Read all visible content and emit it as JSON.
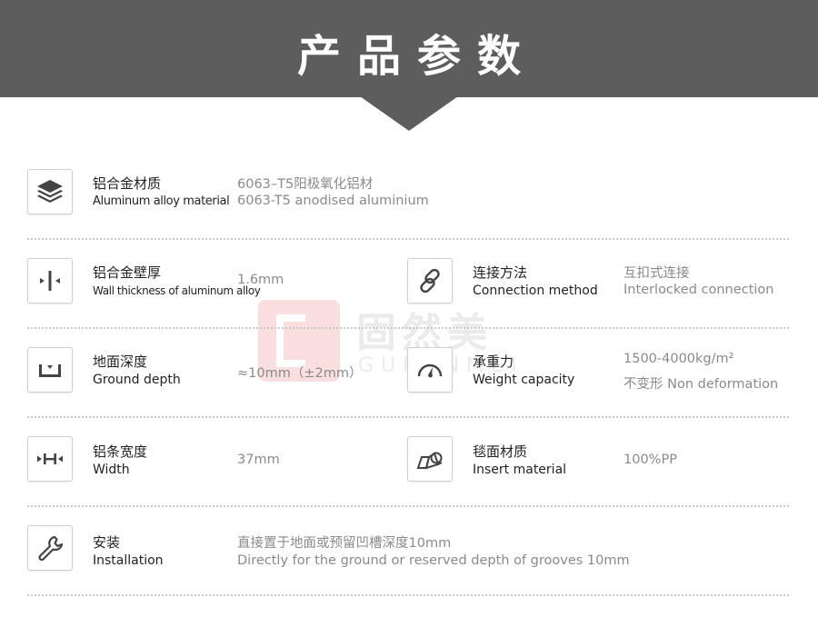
{
  "header": {
    "title": "产品参数"
  },
  "watermark": {
    "cn": "固然美",
    "en": "GURANMEI"
  },
  "rows": [
    {
      "left": {
        "icon": "layers-icon",
        "cn": "铝合金材质",
        "en": "Aluminum alloy material",
        "value_1": "6063–T5阳极氧化铝材",
        "value_2": "6063-T5 anodised aluminium"
      }
    },
    {
      "left": {
        "icon": "thickness-icon",
        "cn": "铝合金壁厚",
        "en": "Wall thickness of aluminum alloy",
        "value_1": "1.6mm",
        "value_2": ""
      },
      "right": {
        "icon": "chain-link-icon",
        "cn": "连接方法",
        "en": "Connection method",
        "value_1": "互扣式连接",
        "value_2": "Interlocked connection"
      }
    },
    {
      "left": {
        "icon": "ground-depth-icon",
        "cn": "地面深度",
        "en": "Ground depth",
        "value_1": "≈10mm（±2mm）",
        "value_2": ""
      },
      "right": {
        "icon": "gauge-icon",
        "cn": "承重力",
        "en": "Weight capacity",
        "value_1": "1500-4000kg/m²",
        "value_2": "不变形 Non deformation"
      }
    },
    {
      "left": {
        "icon": "width-icon",
        "cn": "铝条宽度",
        "en": "Width",
        "value_1": "37mm",
        "value_2": ""
      },
      "right": {
        "icon": "insert-material-icon",
        "cn": "毯面材质",
        "en": "Insert material",
        "value_1": "100%PP",
        "value_2": ""
      }
    },
    {
      "left": {
        "icon": "wrench-icon",
        "cn": "安装",
        "en": "Installation",
        "value_1": "直接置于地面或预留凹槽深度10mm",
        "value_2": "Directly for the ground or reserved depth of grooves 10mm"
      }
    }
  ]
}
